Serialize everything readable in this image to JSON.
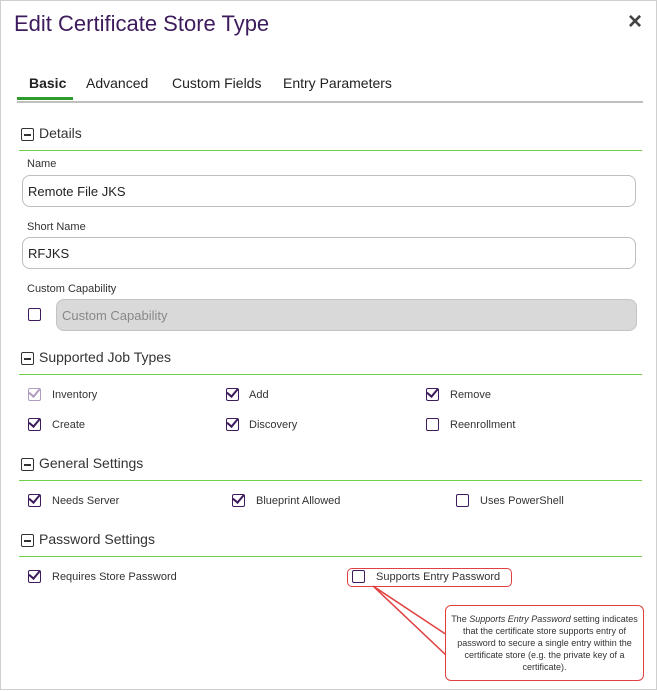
{
  "dialog": {
    "title": "Edit Certificate Store Type",
    "close_icon": "×"
  },
  "tabs": [
    {
      "label": "Basic",
      "active": true
    },
    {
      "label": "Advanced",
      "active": false
    },
    {
      "label": "Custom Fields",
      "active": false
    },
    {
      "label": "Entry Parameters",
      "active": false
    }
  ],
  "details": {
    "title": "Details",
    "name_label": "Name",
    "name_value": "Remote File JKS",
    "short_name_label": "Short Name",
    "short_name_value": "RFJKS",
    "custom_capability_label": "Custom Capability",
    "custom_capability_checked": false,
    "custom_capability_placeholder": "Custom Capability"
  },
  "job_types": {
    "title": "Supported Job Types",
    "items": [
      {
        "label": "Inventory",
        "checked": true,
        "disabled": true
      },
      {
        "label": "Add",
        "checked": true
      },
      {
        "label": "Remove",
        "checked": true
      },
      {
        "label": "Create",
        "checked": true
      },
      {
        "label": "Discovery",
        "checked": true
      },
      {
        "label": "Reenrollment",
        "checked": false
      }
    ]
  },
  "general": {
    "title": "General Settings",
    "items": [
      {
        "label": "Needs Server",
        "checked": true
      },
      {
        "label": "Blueprint Allowed",
        "checked": true
      },
      {
        "label": "Uses PowerShell",
        "checked": false
      }
    ]
  },
  "password": {
    "title": "Password Settings",
    "items": [
      {
        "label": "Requires Store Password",
        "checked": true
      },
      {
        "label": "Supports Entry Password",
        "checked": false
      }
    ]
  },
  "callout": {
    "prefix": "The ",
    "emphasis": "Supports Entry Password",
    "body": " setting indicates that the certificate store supports entry of password to secure a single entry within the certificate store (e.g. the private key of a certificate)."
  },
  "colors": {
    "title": "#3d1b5c",
    "accent_green": "#2e9b2e",
    "section_line": "#6fcf4a",
    "callout_border": "#e04040"
  }
}
